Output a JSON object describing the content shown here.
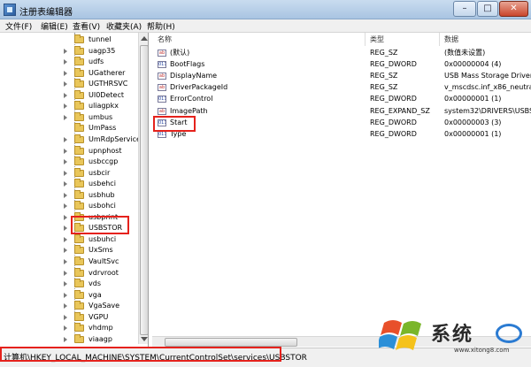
{
  "window": {
    "title": "注册表编辑器",
    "min": "–",
    "max": "□",
    "close": "✕"
  },
  "menu": [
    "文件(F)",
    "编辑(E)",
    "查看(V)",
    "收藏夹(A)",
    "帮助(H)"
  ],
  "tree": {
    "items": [
      "tunnel",
      "uagp35",
      "udfs",
      "UGatherer",
      "UGTHRSVC",
      "UI0Detect",
      "uliagpkx",
      "umbus",
      "UmPass",
      "UmRdpService",
      "upnphost",
      "usbccgp",
      "usbcir",
      "usbehci",
      "usbhub",
      "usbohci",
      "usbprint",
      "USBSTOR",
      "usbuhci",
      "UxSms",
      "VaultSvc",
      "vdrvroot",
      "vds",
      "vga",
      "VgaSave",
      "VGPU",
      "vhdmp",
      "viaagp"
    ],
    "selected": "USBSTOR"
  },
  "columns": {
    "name": "名称",
    "type": "类型",
    "data": "数据"
  },
  "rows": [
    {
      "name": "(默认)",
      "type": "REG_SZ",
      "data": "(数值未设置)",
      "icon": "string-value-icon"
    },
    {
      "name": "BootFlags",
      "type": "REG_DWORD",
      "data": "0x00000004 (4)",
      "icon": "dword-value-icon"
    },
    {
      "name": "DisplayName",
      "type": "REG_SZ",
      "data": "USB Mass Storage Driver",
      "icon": "string-value-icon"
    },
    {
      "name": "DriverPackageId",
      "type": "REG_SZ",
      "data": "v_mscdsc.inf_x86_neutra",
      "icon": "string-value-icon"
    },
    {
      "name": "ErrorControl",
      "type": "REG_DWORD",
      "data": "0x00000001 (1)",
      "icon": "dword-value-icon"
    },
    {
      "name": "ImagePath",
      "type": "REG_EXPAND_SZ",
      "data": "system32\\DRIVERS\\USBS",
      "icon": "string-value-icon"
    },
    {
      "name": "Start",
      "type": "REG_DWORD",
      "data": "0x00000003 (3)",
      "icon": "dword-value-icon"
    },
    {
      "name": "Type",
      "type": "REG_DWORD",
      "data": "0x00000001 (1)",
      "icon": "dword-value-icon"
    }
  ],
  "status": {
    "path": "计算机\\HKEY_LOCAL_MACHINE\\SYSTEM\\CurrentControlSet\\services\\USBSTOR"
  },
  "watermark": {
    "brand": "系统",
    "url": "www.xitong8.com"
  },
  "colors": {
    "highlight_box": "#e5221c",
    "titlebar": "#b9d1ea"
  }
}
